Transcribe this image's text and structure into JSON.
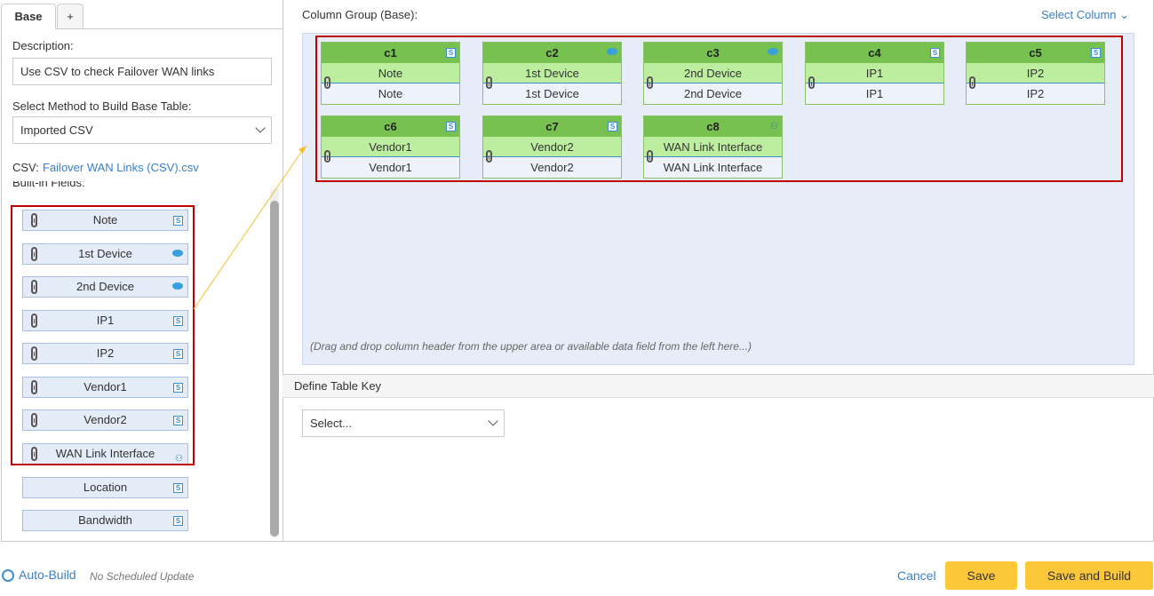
{
  "tabs": [
    "Base",
    "+"
  ],
  "left": {
    "description_label": "Description:",
    "description_value": "Use CSV to check Failover WAN links",
    "method_label": "Select Method to Build Base Table:",
    "method_value": "Imported CSV",
    "csv_label": "CSV:",
    "csv_file": "Failover WAN Links (CSV).csv",
    "builtin_label": "Built-in Fields:",
    "fields": [
      {
        "label": "Note",
        "icon": "string-icon",
        "linked": true
      },
      {
        "label": "1st Device",
        "icon": "device-icon",
        "linked": true
      },
      {
        "label": "2nd Device",
        "icon": "device-icon",
        "linked": true
      },
      {
        "label": "IP1",
        "icon": "string-icon",
        "linked": true
      },
      {
        "label": "IP2",
        "icon": "string-icon",
        "linked": true
      },
      {
        "label": "Vendor1",
        "icon": "string-icon",
        "linked": true
      },
      {
        "label": "Vendor2",
        "icon": "string-icon",
        "linked": true
      },
      {
        "label": "WAN Link Interface",
        "icon": "interface-icon",
        "linked": true
      },
      {
        "label": "Location",
        "icon": "string-icon",
        "linked": false
      },
      {
        "label": "Bandwidth",
        "icon": "string-icon",
        "linked": false
      }
    ]
  },
  "column_group": {
    "title": "Column Group (Base):",
    "select_column": "Select Column",
    "hint": "(Drag and drop column header from the upper area or available data field from the left here...)",
    "columns": [
      {
        "id": "c1",
        "field": "Note",
        "source": "Note",
        "icon": "string-icon"
      },
      {
        "id": "c2",
        "field": "1st Device",
        "source": "1st Device",
        "icon": "device-icon"
      },
      {
        "id": "c3",
        "field": "2nd Device",
        "source": "2nd Device",
        "icon": "device-icon"
      },
      {
        "id": "c4",
        "field": "IP1",
        "source": "IP1",
        "icon": "string-icon"
      },
      {
        "id": "c5",
        "field": "IP2",
        "source": "IP2",
        "icon": "string-icon"
      },
      {
        "id": "c6",
        "field": "Vendor1",
        "source": "Vendor1",
        "icon": "string-icon"
      },
      {
        "id": "c7",
        "field": "Vendor2",
        "source": "Vendor2",
        "icon": "string-icon"
      },
      {
        "id": "c8",
        "field": "WAN Link Interface",
        "source": "WAN Link Interface",
        "icon": "interface-icon"
      }
    ]
  },
  "table_key": {
    "title": "Define Table Key",
    "placeholder": "Select..."
  },
  "footer": {
    "auto_build": "Auto-Build",
    "schedule": "No Scheduled Update",
    "cancel": "Cancel",
    "save": "Save",
    "save_build": "Save and Build"
  },
  "colors": {
    "accent": "#3a8fd0",
    "highlight": "#c00000",
    "button": "#fdc73a",
    "header_green": "#76c14f"
  }
}
